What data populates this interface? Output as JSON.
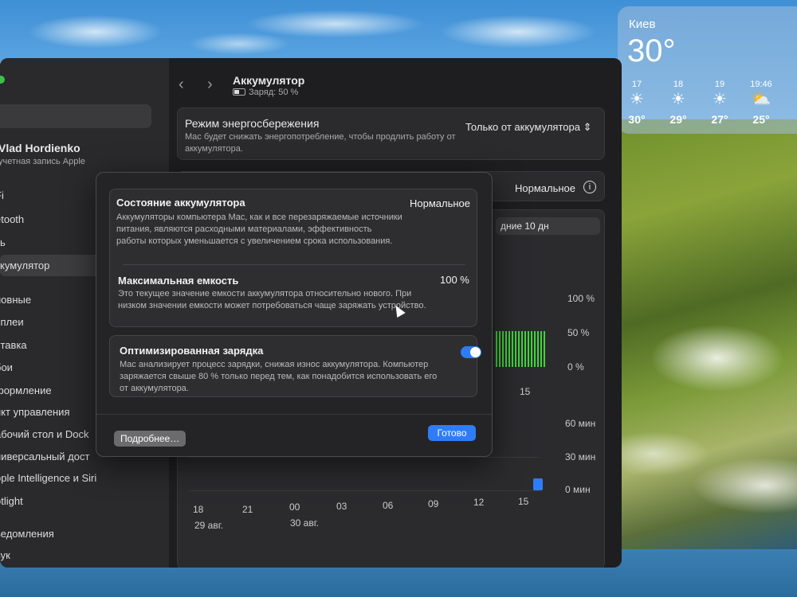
{
  "weather": {
    "city": "Киев",
    "temp": "30°",
    "forecast": [
      {
        "time": "17",
        "icon": "sun-icon",
        "temp": "30°"
      },
      {
        "time": "18",
        "icon": "sun-icon",
        "temp": "29°"
      },
      {
        "time": "19",
        "icon": "sun-icon",
        "temp": "27°"
      },
      {
        "time": "19:46",
        "icon": "sunset-icon",
        "temp": "25°"
      }
    ]
  },
  "sidebar": {
    "user_name": "Vlad Hordienko",
    "user_sub": "учетная запись Apple",
    "items": [
      "Fi",
      "etooth",
      "ть",
      "кумулятор",
      "новные",
      "сплеи",
      "ставка",
      "бои",
      "формление",
      "нкт управления",
      "абочий стол и Dock",
      "ниверсальный дост",
      "ople Intelligence и Siri",
      "otlight",
      "ведомления",
      "вук"
    ]
  },
  "header": {
    "title": "Аккумулятор",
    "subtitle": "Заряд: 50 %"
  },
  "power_mode": {
    "title": "Режим энергосбережения",
    "desc": "Mac будет снижать энергопотребление, чтобы продлить работу от аккумулятора.",
    "value": "Только от аккумулятора"
  },
  "health": {
    "value": "Нормальное"
  },
  "period": {
    "label": "дние 10 дн"
  },
  "chart": {
    "y_top": [
      "100 %",
      "50 %",
      "0 %"
    ],
    "y_bottom": [
      "60 мин",
      "30 мин",
      "0 мин"
    ],
    "x_top": "15",
    "x": [
      "18",
      "21",
      "00",
      "03",
      "06",
      "09",
      "12",
      "15"
    ],
    "dates": [
      "29 авг.",
      "30 авг."
    ]
  },
  "dialog": {
    "state_title": "Состояние аккумулятора",
    "state_value": "Нормальное",
    "state_desc": "Аккумуляторы компьютера Mac, как и все перезаряжаемые источники питания, являются расходными материалами, эффективность работы которых уменьшается с увеличением срока использования.",
    "capacity_title": "Максимальная емкость",
    "capacity_value": "100 %",
    "capacity_desc": "Это текущее значение емкости аккумулятора относительно нового. При низком значении емкости может потребоваться чаще заряжать устройство.",
    "opt_title": "Оптимизированная зарядка",
    "opt_desc": "Mac анализирует процесс зарядки, снижая износ аккумулятора. Компьютер заряжается свыше 80 % только перед тем, как понадобится использовать его от аккумулятора.",
    "more_label": "Подробнее…",
    "done_label": "Готово"
  }
}
